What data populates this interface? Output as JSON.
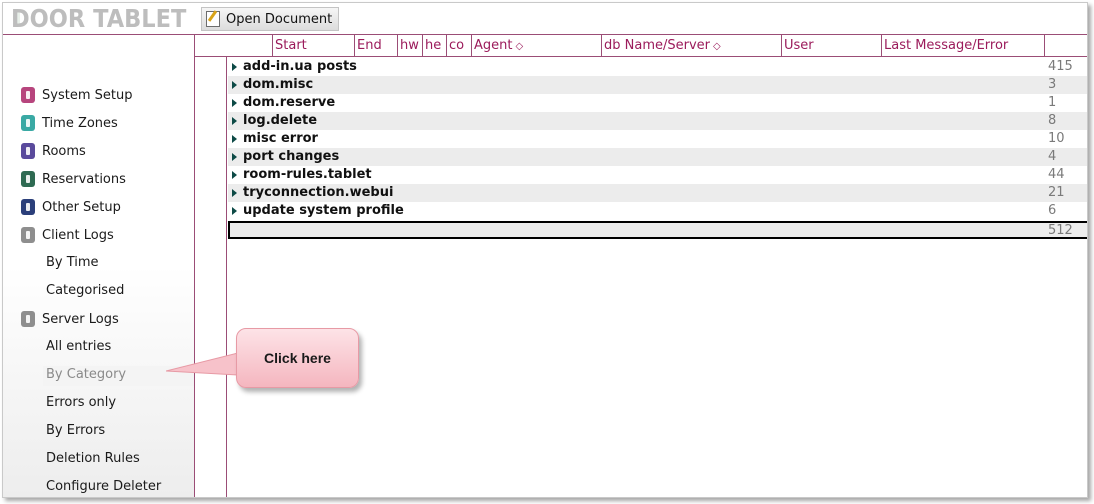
{
  "brand": {
    "logo_text": "DOOR TABLET",
    "accent": "#9b4d76"
  },
  "toolbar": {
    "open_document": "Open Document"
  },
  "sidebar": {
    "items": [
      {
        "label": "System Setup",
        "icon": "app-icon",
        "color": "#b7457d"
      },
      {
        "label": "Time Zones",
        "icon": "app-icon",
        "color": "#3aa9a4"
      },
      {
        "label": "Rooms",
        "icon": "app-icon",
        "color": "#5a4a9c"
      },
      {
        "label": "Reservations",
        "icon": "app-icon",
        "color": "#2e6a52"
      },
      {
        "label": "Other Setup",
        "icon": "app-icon",
        "color": "#2b3f7a"
      },
      {
        "label": "Client Logs",
        "icon": "app-icon",
        "color": "#8e8e8e"
      }
    ],
    "client_logs_sub": [
      "By Time",
      "Categorised"
    ],
    "server_logs": {
      "label": "Server Logs",
      "icon": "app-icon",
      "color": "#8e8e8e"
    },
    "server_logs_sub": [
      "All entries",
      "By Category",
      "Errors only",
      "By Errors",
      "Deletion Rules",
      "Configure Deleter"
    ]
  },
  "table": {
    "headers": {
      "start": "Start",
      "end": "End",
      "hw": "hw",
      "he": "he",
      "co": "co",
      "agent": "Agent",
      "db": "db Name/Server",
      "user": "User",
      "last": "Last Message/Error"
    },
    "rows": [
      {
        "category": "add-in.ua posts",
        "count": "415"
      },
      {
        "category": "dom.misc",
        "count": "3"
      },
      {
        "category": "dom.reserve",
        "count": "1"
      },
      {
        "category": "log.delete",
        "count": "8"
      },
      {
        "category": "misc error",
        "count": "10"
      },
      {
        "category": "port changes",
        "count": "4"
      },
      {
        "category": "room-rules.tablet",
        "count": "44"
      },
      {
        "category": "tryconnection.webui",
        "count": "21"
      },
      {
        "category": "update system profile",
        "count": "6"
      }
    ],
    "total": "512"
  },
  "callout": {
    "text": "Click here"
  }
}
